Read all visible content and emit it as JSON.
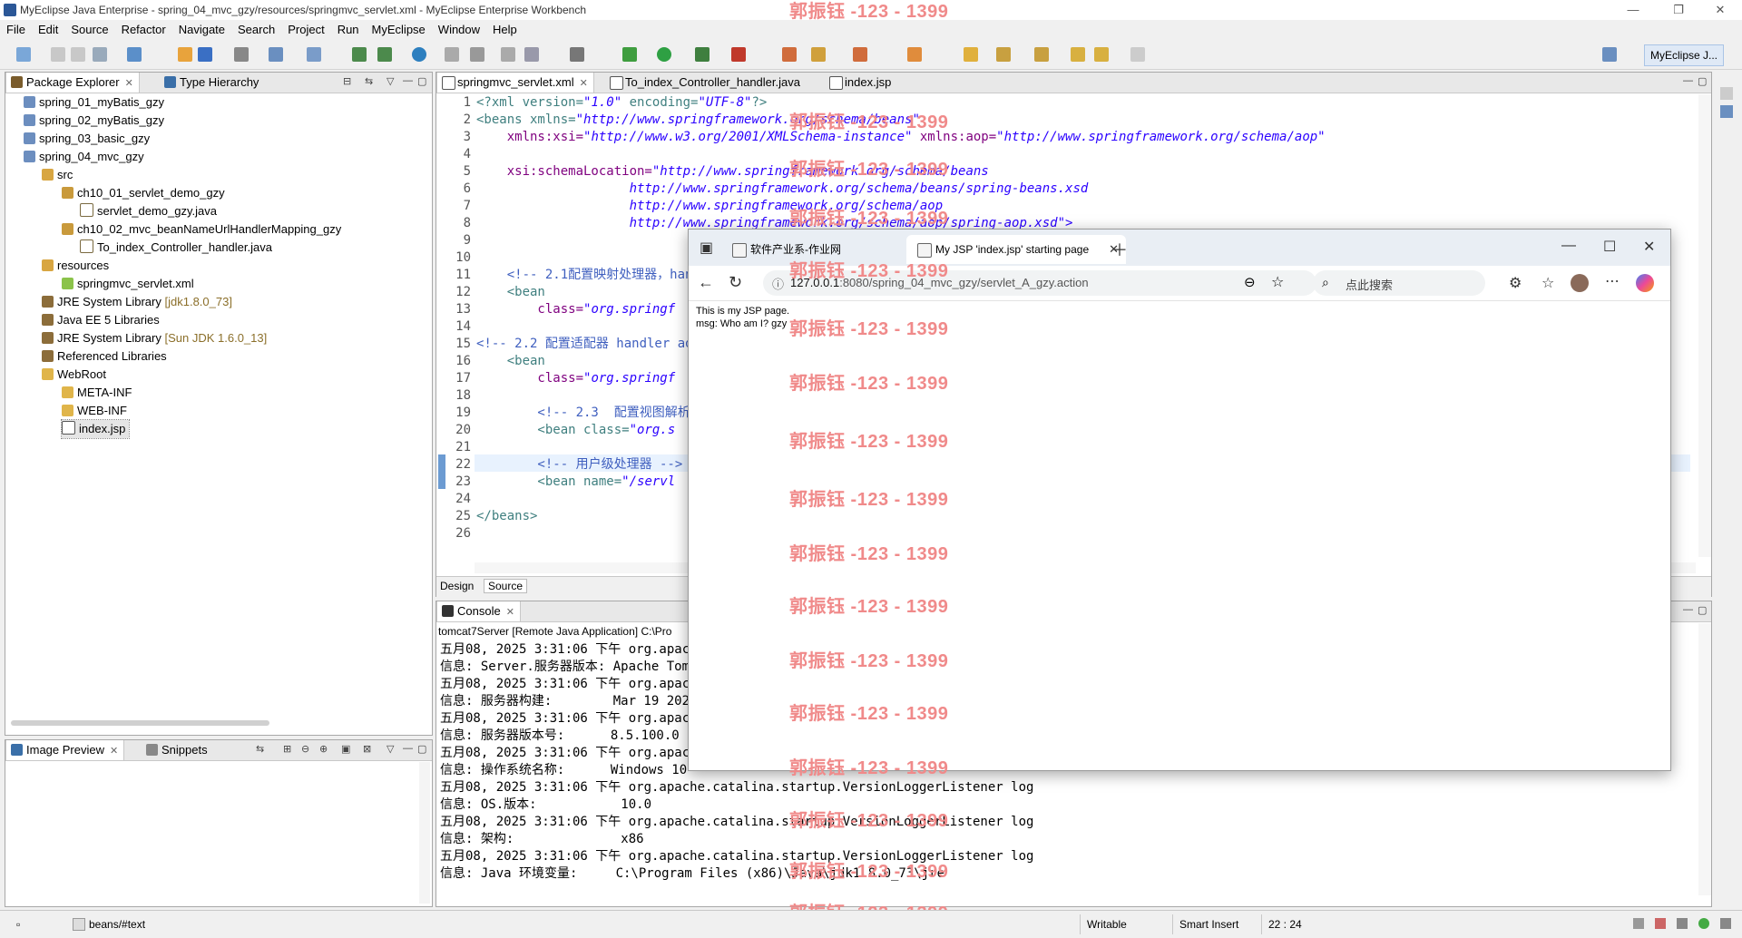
{
  "window": {
    "title": "MyEclipse Java Enterprise - spring_04_mvc_gzy/resources/springmvc_servlet.xml - MyEclipse Enterprise Workbench"
  },
  "menu": [
    "File",
    "Edit",
    "Source",
    "Refactor",
    "Navigate",
    "Search",
    "Project",
    "Run",
    "MyEclipse",
    "Window",
    "Help"
  ],
  "perspective": "MyEclipse J...",
  "package_explorer": {
    "tab1": "Package Explorer",
    "tab2": "Type Hierarchy",
    "items": [
      {
        "label": "spring_01_myBatis_gzy",
        "sub": ""
      },
      {
        "label": "spring_02_myBatis_gzy",
        "sub": ""
      },
      {
        "label": "spring_03_basic_gzy",
        "sub": ""
      },
      {
        "label": "spring_04_mvc_gzy",
        "sub": ""
      },
      {
        "label": "src",
        "sub": ""
      },
      {
        "label": "ch10_01_servlet_demo_gzy",
        "sub": ""
      },
      {
        "label": "servlet_demo_gzy.java",
        "sub": ""
      },
      {
        "label": "ch10_02_mvc_beanNameUrlHandlerMapping_gzy",
        "sub": ""
      },
      {
        "label": "To_index_Controller_handler.java",
        "sub": ""
      },
      {
        "label": "resources",
        "sub": ""
      },
      {
        "label": "springmvc_servlet.xml",
        "sub": ""
      },
      {
        "label": "JRE System Library",
        "sub": "[jdk1.8.0_73]"
      },
      {
        "label": "Java EE 5 Libraries",
        "sub": ""
      },
      {
        "label": "JRE System Library",
        "sub": "[Sun JDK 1.6.0_13]"
      },
      {
        "label": "Referenced Libraries",
        "sub": ""
      },
      {
        "label": "WebRoot",
        "sub": ""
      },
      {
        "label": "META-INF",
        "sub": ""
      },
      {
        "label": "WEB-INF",
        "sub": ""
      },
      {
        "label": "index.jsp",
        "sub": ""
      }
    ]
  },
  "image_preview": {
    "tab1": "Image Preview",
    "tab2": "Snippets"
  },
  "editor": {
    "tabs": [
      "springmvc_servlet.xml",
      "To_index_Controller_handler.java",
      "index.jsp"
    ],
    "bottom_tabs": [
      "Design",
      "Source"
    ],
    "line_numbers": [
      "1",
      "2",
      "3",
      "4",
      "5",
      "6",
      "7",
      "8",
      "9",
      "10",
      "11",
      "12",
      "13",
      "14",
      "15",
      "16",
      "17",
      "18",
      "19",
      "20",
      "21",
      "22",
      "23",
      "24",
      "25",
      "26"
    ],
    "lines": {
      "l1a": "<?xml version=",
      "l1b": "\"1.0\"",
      "l1c": " encoding=",
      "l1d": "\"UTF-8\"",
      "l1e": "?>",
      "l2a": "<beans xmlns=",
      "l2b": "\"http://www.springframework.org/schema/beans\"",
      "l3a": "    xmlns:xsi=",
      "l3b": "\"http://www.w3.org/2001/XMLSchema-instance\"",
      "l3c": " xmlns:aop=",
      "l3d": "\"http://www.springframework.org/schema/aop\"",
      "l5a": "    xsi:schemaLocation=",
      "l5b": "\"http://www.springframework.org/schema/beans",
      "l6": "http://www.springframework.org/schema/beans/spring-beans.xsd",
      "l7": "http://www.springframework.org/schema/aop",
      "l8": "http://www.springframework.org/schema/aop/spring-aop.xsd\">",
      "l11": "    <!-- 2.1配置映射处理器，han",
      "l12": "    <bean",
      "l13a": "        class=",
      "l13b": "\"org.springf",
      "l15": "<!-- 2.2 配置适配器 handler ad",
      "l16": "    <bean",
      "l17a": "        class=",
      "l17b": "\"org.springf",
      "l19": "        <!-- 2.3  配置视图解析器",
      "l20a": "        <bean class=",
      "l20b": "\"org.s",
      "l22": "        <!-- 用户级处理器 -->",
      "l23a": "        <bean name=",
      "l23b": "\"/servl",
      "l25": "</beans>"
    }
  },
  "console": {
    "tab": "Console",
    "header": "tomcat7Server [Remote Java Application] C:\\Pro",
    "lines": [
      "五月08, 2025 3:31:06 下午 org.apac",
      "信息: Server.服务器版本: Apache Tom",
      "五月08, 2025 3:31:06 下午 org.apac",
      "信息: 服务器构建:        Mar 19 2024",
      "五月08, 2025 3:31:06 下午 org.apac",
      "信息: 服务器版本号:      8.5.100.0",
      "五月08, 2025 3:31:06 下午 org.apac",
      "信息: 操作系统名称:      Windows 10",
      "五月08, 2025 3:31:06 下午 org.apache.catalina.startup.VersionLoggerListener log",
      "信息: OS.版本:           10.0",
      "五月08, 2025 3:31:06 下午 org.apache.catalina.startup.VersionLoggerListener log",
      "信息: 架构:              x86",
      "五月08, 2025 3:31:06 下午 org.apache.catalina.startup.VersionLoggerListener log",
      "信息: Java 环境变量:     C:\\Program Files (x86)\\Java\\jdk1.8.0_73\\jre"
    ]
  },
  "browser": {
    "tab1": "软件产业系-作业网",
    "tab2": "My JSP 'index.jsp' starting page",
    "url_host": "127.0.0.1",
    "url_rest": ":8080/spring_04_mvc_gzy/servlet_A_gzy.action",
    "search_placeholder": "点此搜索",
    "content_line1": "This is my JSP page.",
    "content_line2": "msg: Who am I? gzy"
  },
  "watermark": "郭振钰 -123 - 1399",
  "status": {
    "path": "beans/#text",
    "writable": "Writable",
    "insert": "Smart Insert",
    "position": "22 : 24"
  }
}
